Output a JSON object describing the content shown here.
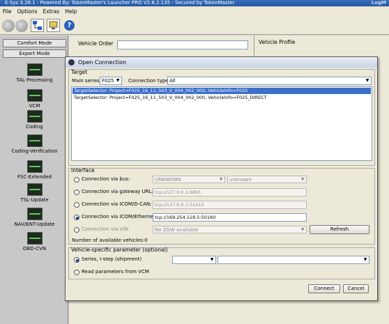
{
  "window": {
    "title": "E-Sys 3.28.1 - Powered By: TokenMaster's Launcher PRO V2.6.2.135 - Secured by TokenMaster",
    "brand": "LogM"
  },
  "menu": [
    "File",
    "Options",
    "Extras",
    "Help"
  ],
  "sidebar": {
    "comfort_mode": "Comfort Mode",
    "expert_mode": "Expert Mode",
    "items": [
      "TAL-Processing",
      "VCM",
      "Coding",
      "Coding-Verification",
      "FSC-Extended",
      "TSL-Update",
      "NAV/ENT-Update",
      "OBD-CVN"
    ]
  },
  "main": {
    "vehicle_order_label": "Vehicle Order",
    "vehicle_profile_label": "Vehicle Profile"
  },
  "dialog": {
    "title": "Open Connection",
    "target": {
      "label": "Target",
      "main_series_label": "Main series:",
      "main_series_value": "F025",
      "connection_type_label": "Connection type:",
      "connection_type_value": "All",
      "rows": [
        "TargetSelector: Project=F025_16_11_503_V_004_002_000, VehicleInfo=F025",
        "TargetSelector: Project=F025_16_11_503_V_004_002_000, VehicleInfo=F025_DIRECT"
      ]
    },
    "interface": {
      "label": "Interface",
      "bus_label": "Connection via bus:",
      "bus_value1": "UNKNOWN",
      "bus_value2": "unknown",
      "gateway_label": "Connection via gateway URL:",
      "gateway_value": "tcp://127.0.0.1:6801",
      "icom_dcan_label": "Connection via ICOM/D-CAN:",
      "icom_dcan_value": "tcp://127.0.0.1:52410",
      "icom_eth_label": "Connection via ICOM/Ethernet:",
      "icom_eth_value": "tcp://169.254.119.5:50160",
      "vin_label": "Connection via VIN:",
      "vin_value": "No ZGW available",
      "refresh": "Refresh",
      "available": "Number of available vehicles:0"
    },
    "vehicle_param": {
      "label": "Vehicle-specific parameter (optional)",
      "series_label": "Series, I-step (shipment)",
      "read_label": "Read parameters from VCM"
    },
    "connect": "Connect",
    "cancel": "Cancel"
  }
}
